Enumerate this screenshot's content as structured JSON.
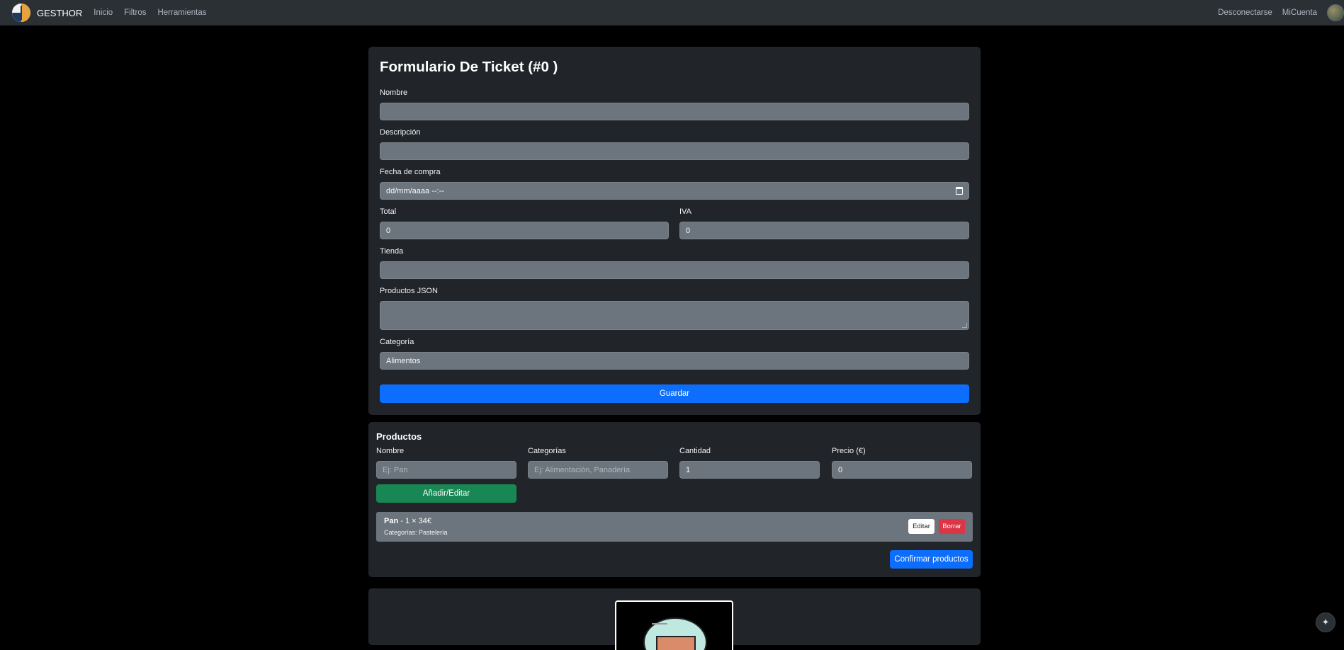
{
  "nav": {
    "brand": "GESTHOR",
    "links": [
      "Inicio",
      "Filtros",
      "Herramientas"
    ],
    "right_links": [
      "Desconectarse",
      "MiCuenta"
    ]
  },
  "form": {
    "title": "Formulario De Ticket (#0 )",
    "nombre_label": "Nombre",
    "nombre_value": "",
    "descripcion_label": "Descripción",
    "descripcion_value": "",
    "fecha_label": "Fecha de compra",
    "fecha_placeholder": "dd/mm/aaaa --:--",
    "total_label": "Total",
    "total_value": "0",
    "iva_label": "IVA",
    "iva_value": "0",
    "tienda_label": "Tienda",
    "tienda_value": "",
    "productos_json_label": "Productos JSON",
    "productos_json_value": "",
    "categoria_label": "Categoría",
    "categoria_value": "Alimentos",
    "save_label": "Guardar"
  },
  "productos": {
    "title": "Productos",
    "nombre_label": "Nombre",
    "nombre_placeholder": "Ej: Pan",
    "categorias_label": "Categorías",
    "categorias_placeholder": "Ej: Alimentación, Panadería",
    "cantidad_label": "Cantidad",
    "cantidad_value": "1",
    "precio_label": "Precio (€)",
    "precio_value": "0",
    "add_label": "Añadir/Editar",
    "items": [
      {
        "name": "Pan",
        "detail": " - 1 × 34€",
        "categories": "Categorías: Pastelería",
        "edit_label": "Editar",
        "delete_label": "Borrar"
      }
    ],
    "confirm_label": "Confirmar productos"
  },
  "colors": {
    "primary": "#0d6efd",
    "success": "#198754",
    "danger": "#dc3545",
    "card_bg": "#212529",
    "input_bg": "#6c757d"
  },
  "icons": [
    "logo-icon",
    "avatar",
    "calendar-icon",
    "sparkle-icon",
    "illustration-cloud-box"
  ]
}
